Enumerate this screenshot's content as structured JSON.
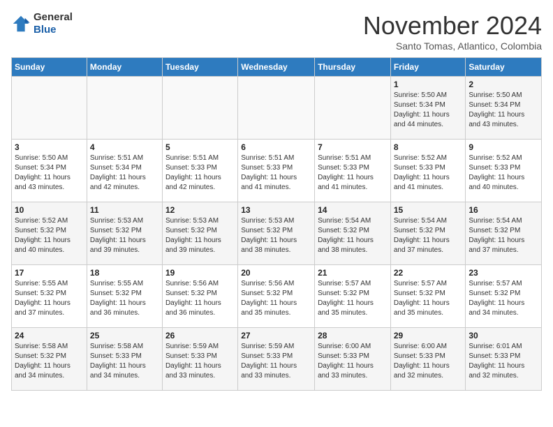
{
  "header": {
    "logo_line1": "General",
    "logo_line2": "Blue",
    "month": "November 2024",
    "location": "Santo Tomas, Atlantico, Colombia"
  },
  "weekdays": [
    "Sunday",
    "Monday",
    "Tuesday",
    "Wednesday",
    "Thursday",
    "Friday",
    "Saturday"
  ],
  "weeks": [
    [
      {
        "day": "",
        "info": ""
      },
      {
        "day": "",
        "info": ""
      },
      {
        "day": "",
        "info": ""
      },
      {
        "day": "",
        "info": ""
      },
      {
        "day": "",
        "info": ""
      },
      {
        "day": "1",
        "info": "Sunrise: 5:50 AM\nSunset: 5:34 PM\nDaylight: 11 hours\nand 44 minutes."
      },
      {
        "day": "2",
        "info": "Sunrise: 5:50 AM\nSunset: 5:34 PM\nDaylight: 11 hours\nand 43 minutes."
      }
    ],
    [
      {
        "day": "3",
        "info": "Sunrise: 5:50 AM\nSunset: 5:34 PM\nDaylight: 11 hours\nand 43 minutes."
      },
      {
        "day": "4",
        "info": "Sunrise: 5:51 AM\nSunset: 5:34 PM\nDaylight: 11 hours\nand 42 minutes."
      },
      {
        "day": "5",
        "info": "Sunrise: 5:51 AM\nSunset: 5:33 PM\nDaylight: 11 hours\nand 42 minutes."
      },
      {
        "day": "6",
        "info": "Sunrise: 5:51 AM\nSunset: 5:33 PM\nDaylight: 11 hours\nand 41 minutes."
      },
      {
        "day": "7",
        "info": "Sunrise: 5:51 AM\nSunset: 5:33 PM\nDaylight: 11 hours\nand 41 minutes."
      },
      {
        "day": "8",
        "info": "Sunrise: 5:52 AM\nSunset: 5:33 PM\nDaylight: 11 hours\nand 41 minutes."
      },
      {
        "day": "9",
        "info": "Sunrise: 5:52 AM\nSunset: 5:33 PM\nDaylight: 11 hours\nand 40 minutes."
      }
    ],
    [
      {
        "day": "10",
        "info": "Sunrise: 5:52 AM\nSunset: 5:32 PM\nDaylight: 11 hours\nand 40 minutes."
      },
      {
        "day": "11",
        "info": "Sunrise: 5:53 AM\nSunset: 5:32 PM\nDaylight: 11 hours\nand 39 minutes."
      },
      {
        "day": "12",
        "info": "Sunrise: 5:53 AM\nSunset: 5:32 PM\nDaylight: 11 hours\nand 39 minutes."
      },
      {
        "day": "13",
        "info": "Sunrise: 5:53 AM\nSunset: 5:32 PM\nDaylight: 11 hours\nand 38 minutes."
      },
      {
        "day": "14",
        "info": "Sunrise: 5:54 AM\nSunset: 5:32 PM\nDaylight: 11 hours\nand 38 minutes."
      },
      {
        "day": "15",
        "info": "Sunrise: 5:54 AM\nSunset: 5:32 PM\nDaylight: 11 hours\nand 37 minutes."
      },
      {
        "day": "16",
        "info": "Sunrise: 5:54 AM\nSunset: 5:32 PM\nDaylight: 11 hours\nand 37 minutes."
      }
    ],
    [
      {
        "day": "17",
        "info": "Sunrise: 5:55 AM\nSunset: 5:32 PM\nDaylight: 11 hours\nand 37 minutes."
      },
      {
        "day": "18",
        "info": "Sunrise: 5:55 AM\nSunset: 5:32 PM\nDaylight: 11 hours\nand 36 minutes."
      },
      {
        "day": "19",
        "info": "Sunrise: 5:56 AM\nSunset: 5:32 PM\nDaylight: 11 hours\nand 36 minutes."
      },
      {
        "day": "20",
        "info": "Sunrise: 5:56 AM\nSunset: 5:32 PM\nDaylight: 11 hours\nand 35 minutes."
      },
      {
        "day": "21",
        "info": "Sunrise: 5:57 AM\nSunset: 5:32 PM\nDaylight: 11 hours\nand 35 minutes."
      },
      {
        "day": "22",
        "info": "Sunrise: 5:57 AM\nSunset: 5:32 PM\nDaylight: 11 hours\nand 35 minutes."
      },
      {
        "day": "23",
        "info": "Sunrise: 5:57 AM\nSunset: 5:32 PM\nDaylight: 11 hours\nand 34 minutes."
      }
    ],
    [
      {
        "day": "24",
        "info": "Sunrise: 5:58 AM\nSunset: 5:32 PM\nDaylight: 11 hours\nand 34 minutes."
      },
      {
        "day": "25",
        "info": "Sunrise: 5:58 AM\nSunset: 5:33 PM\nDaylight: 11 hours\nand 34 minutes."
      },
      {
        "day": "26",
        "info": "Sunrise: 5:59 AM\nSunset: 5:33 PM\nDaylight: 11 hours\nand 33 minutes."
      },
      {
        "day": "27",
        "info": "Sunrise: 5:59 AM\nSunset: 5:33 PM\nDaylight: 11 hours\nand 33 minutes."
      },
      {
        "day": "28",
        "info": "Sunrise: 6:00 AM\nSunset: 5:33 PM\nDaylight: 11 hours\nand 33 minutes."
      },
      {
        "day": "29",
        "info": "Sunrise: 6:00 AM\nSunset: 5:33 PM\nDaylight: 11 hours\nand 32 minutes."
      },
      {
        "day": "30",
        "info": "Sunrise: 6:01 AM\nSunset: 5:33 PM\nDaylight: 11 hours\nand 32 minutes."
      }
    ]
  ]
}
